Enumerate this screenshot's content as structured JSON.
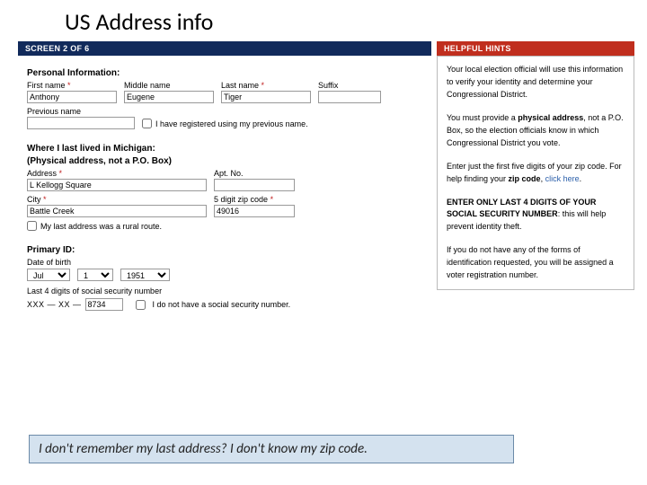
{
  "title": "US Address info",
  "left_banner": "SCREEN 2 OF 6",
  "right_banner": "HELPFUL HINTS",
  "personal": {
    "heading": "Personal Information:",
    "first_label": "First name",
    "middle_label": "Middle name",
    "last_label": "Last name",
    "suffix_label": "Suffix",
    "first": "Anthony",
    "middle": "Eugene",
    "last": "Tiger",
    "suffix": "",
    "prev_label": "Previous name",
    "prev": "",
    "prev_cb": "I have registered using my previous name."
  },
  "addr": {
    "heading": "Where I last lived in Michigan:",
    "sub": "(Physical address, not a P.O. Box)",
    "address_label": "Address",
    "apt_label": "Apt. No.",
    "address": "L Kellogg Square",
    "apt": "",
    "city_label": "City",
    "zip_label": "5 digit zip code",
    "city": "Battle Creek",
    "zip": "49016",
    "rural_cb": "My last address was a rural route."
  },
  "id": {
    "heading": "Primary ID:",
    "dob_label": "Date of birth",
    "month": "Jul",
    "day": "1",
    "year": "1951",
    "ssn_label": "Last 4 digits of social security number",
    "mask": "XXX — XX —",
    "ssn": "8734",
    "no_ssn_cb": "I do not have a social security number."
  },
  "hints": {
    "p1": "Your local election official will use this information to verify your identity and determine your Congressional District.",
    "p2a": "You must provide a ",
    "p2b": "physical address",
    "p2c": ", not a P.O. Box, so the election officials know in which Congressional District you vote.",
    "p3a": "Enter just the first five digits of your zip code. For help finding your ",
    "p3b": "zip code",
    "p3c": ", ",
    "p3link": "click here",
    "p3d": ".",
    "p4a": "ENTER ONLY LAST 4 DIGITS OF YOUR SOCIAL SECURITY NUMBER",
    "p4b": ": this will help prevent identity theft.",
    "p5": "If you do not have any of the forms of identification requested, you will be assigned a voter registration number."
  },
  "asterisk": "*",
  "callout": "I don't remember my last address?  I don't know my zip code."
}
